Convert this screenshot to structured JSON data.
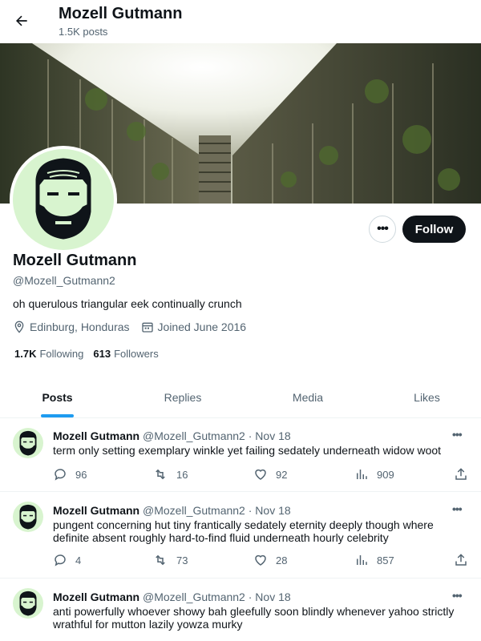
{
  "header": {
    "title": "Mozell Gutmann",
    "posts_count": "1.5K posts"
  },
  "profile": {
    "name": "Mozell Gutmann",
    "handle": "@Mozell_Gutmann2",
    "bio": "oh querulous triangular eek continually crunch",
    "location": "Edinburg, Honduras",
    "joined": "Joined June 2016",
    "following_count": "1.7K",
    "following_label": "Following",
    "followers_count": "613",
    "followers_label": "Followers",
    "follow_label": "Follow",
    "more_label": "•••"
  },
  "tabs": [
    {
      "label": "Posts"
    },
    {
      "label": "Replies"
    },
    {
      "label": "Media"
    },
    {
      "label": "Likes"
    }
  ],
  "tweets": [
    {
      "name": "Mozell Gutmann",
      "handle": "@Mozell_Gutmann2",
      "sep": "·",
      "date": "Nov 18",
      "text": "term only setting exemplary winkle yet failing sedately underneath widow woot",
      "replies": "96",
      "reposts": "16",
      "likes": "92",
      "views": "909"
    },
    {
      "name": "Mozell Gutmann",
      "handle": "@Mozell_Gutmann2",
      "sep": "·",
      "date": "Nov 18",
      "text": "pungent concerning hut tiny frantically sedately eternity deeply though where definite absent roughly hard-to-find fluid underneath hourly celebrity",
      "replies": "4",
      "reposts": "73",
      "likes": "28",
      "views": "857"
    },
    {
      "name": "Mozell Gutmann",
      "handle": "@Mozell_Gutmann2",
      "sep": "·",
      "date": "Nov 18",
      "text": "anti powerfully whoever showy bah gleefully soon blindly whenever yahoo strictly wrathful for mutton lazily yowza murky",
      "replies": "",
      "reposts": "",
      "likes": "",
      "views": ""
    }
  ],
  "tweet_more_label": "•••",
  "colors": {
    "accent": "#1d9bf0",
    "text": "#0f1419",
    "muted": "#536471",
    "avatar_bg": "#d8f4cf"
  }
}
